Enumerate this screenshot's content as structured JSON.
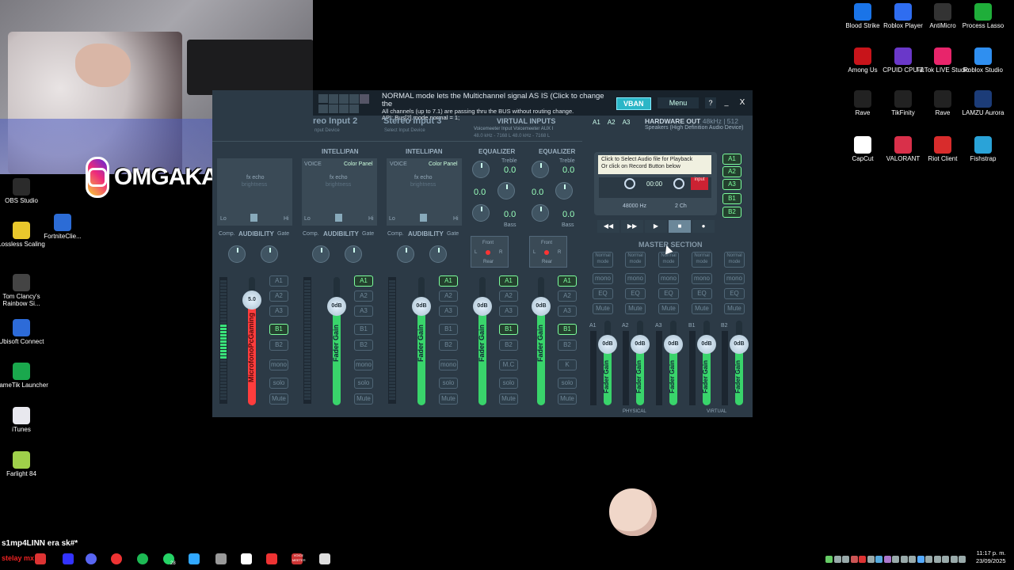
{
  "overlay": {
    "instagram_handle": "OMGAKA_",
    "chat_user": "s1mp4LINN",
    "chat_message": "era sk#*",
    "chat_label": "stelay mx"
  },
  "desktop_left_icons": [
    {
      "name": "obs-studio-icon",
      "label": "OBS Studio",
      "color": "#2b2b2b"
    },
    {
      "name": "lossless-scaling-icon",
      "label": "Lossless Scaling",
      "color": "#e9c82c"
    },
    {
      "name": "fortnite-client-icon",
      "label": "FortniteClie...",
      "color": "#2c6cd6"
    },
    {
      "name": "rainbow-six-icon",
      "label": "Tom Clancy's Rainbow Si...",
      "color": "#444"
    },
    {
      "name": "ubisoft-icon",
      "label": "Ubisoft Connect",
      "color": "#2d6bd8"
    },
    {
      "name": "gametik-icon",
      "label": "GameTik Launcher",
      "color": "#1aa84d"
    },
    {
      "name": "itunes-icon",
      "label": "iTunes",
      "color": "#e8e8ee"
    },
    {
      "name": "farlight-icon",
      "label": "Farlight 84",
      "color": "#9fd14a"
    }
  ],
  "desktop_right_icons": [
    {
      "name": "blood-strike-icon",
      "label": "Blood Strike",
      "color": "#1a74e8"
    },
    {
      "name": "roblox-player-icon",
      "label": "Roblox Player",
      "color": "#2f6df0"
    },
    {
      "name": "antimicro-icon",
      "label": "AntiMicro",
      "color": "#333"
    },
    {
      "name": "process-lasso-icon",
      "label": "Process Lasso",
      "color": "#1fae3a"
    },
    {
      "name": "among-us-icon",
      "label": "Among Us",
      "color": "#c8141a"
    },
    {
      "name": "cpuid-icon",
      "label": "CPUID CPU-Z",
      "color": "#6a38c9"
    },
    {
      "name": "tiktok-live-icon",
      "label": "TikTok LIVE Studio",
      "color": "#e8256b"
    },
    {
      "name": "roblox-studio-icon",
      "label": "Roblox Studio",
      "color": "#2f8ff0"
    },
    {
      "name": "rave-icon",
      "label": "Rave",
      "color": "#222"
    },
    {
      "name": "tikfinity-icon",
      "label": "TikFinity",
      "color": "#222"
    },
    {
      "name": "rave2-icon",
      "label": "Rave",
      "color": "#222"
    },
    {
      "name": "lamzu-icon",
      "label": "LAMZU Aurora",
      "color": "#1c3c78"
    },
    {
      "name": "capcut-icon",
      "label": "CapCut",
      "color": "#fff"
    },
    {
      "name": "valorant-icon",
      "label": "VALORANT",
      "color": "#d9304a"
    },
    {
      "name": "riot-client-icon",
      "label": "Riot Client",
      "color": "#d82c2c"
    },
    {
      "name": "fishstrap-icon",
      "label": "Fishstrap",
      "color": "#2aa3d8"
    }
  ],
  "voicemeeter": {
    "status_line1": "NORMAL mode lets the Multichannel signal AS IS (Click to change the",
    "status_line2": "All channels (up to 7.1) are passing thru the BUS without routing change.",
    "status_line3": "API: Bus[2].mode.normal = 1;",
    "vban": "VBAN",
    "menu": "Menu",
    "help": "?",
    "minimize": "_",
    "close": "X",
    "inputs": [
      {
        "title": "reo Input 2",
        "subtitle": "nput Device"
      },
      {
        "title": "Stereo Input 3",
        "subtitle": "Select Input Device"
      }
    ],
    "virtual_inputs": "VIRTUAL INPUTS",
    "vi_line1": "Voicemeeter Input    Voicemeeter AUX I",
    "vi_line2": "48.0 kHz - 7168 L      48.0 kHz - 7168 L",
    "hw_out_title": "HARDWARE OUT",
    "hw_out_rate": "48kHz | 512",
    "hw_out_device": "Speakers (High Definition Audio Device)",
    "a_buttons": [
      "A1",
      "A2",
      "A3"
    ],
    "intellipan": "INTELLIPAN",
    "equalizer": "EQUALIZER",
    "voice": "VOICE",
    "color_panel": "Color Panel",
    "fx_echo": "fx echo",
    "brightness": "brightness",
    "lo": "Lo",
    "hi": "Hi",
    "treble": "Treble",
    "bass": "Bass",
    "eq_value": "0.0",
    "comp": "Comp.",
    "audibility": "AUDIBILITY",
    "gate": "Gate",
    "front": "Front",
    "rear": "Rear",
    "l": "L",
    "r": "R",
    "strip_bus": [
      "A1",
      "A2",
      "A3",
      "B1",
      "B2"
    ],
    "mono": "mono",
    "solo": "solo",
    "mute": "Mute",
    "mc": "M.C",
    "k": "K",
    "gain_red": "5.0",
    "gain_zero": "0dB",
    "red_label": "MicrofonoPcGaming",
    "fader_gain": "Fader Gain",
    "recorder": {
      "hint1": "Click to Select Audio file for Playback",
      "hint2": "Or click on Record Button below",
      "time": "00:00",
      "input": "input",
      "rate": "48000 Hz",
      "ch": "2 Ch"
    },
    "recorder_bus": [
      "A1",
      "A2",
      "A3",
      "B1",
      "B2"
    ],
    "master_section": "MASTER SECTION",
    "normal_mode": "Normal mode",
    "eq": "EQ",
    "master_labels": [
      "A1",
      "A2",
      "A3",
      "B1",
      "B2"
    ],
    "physical": "PHYSICAL",
    "virtual": "VIRTUAL"
  },
  "taskbar": {
    "clock_time": "11:17 p. m.",
    "clock_date": "23/09/2025",
    "badge": "28",
    "voicemeeter_tab": "VOICE MEETER"
  }
}
